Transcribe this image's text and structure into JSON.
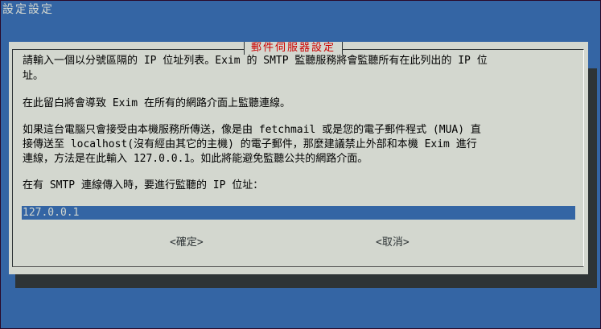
{
  "backtitle": "設定設定",
  "dialog": {
    "title": "郵件伺服器設定",
    "lines": [
      "請輸入一個以分號區隔的 IP 位址列表。Exim 的 SMTP 監聽服務將會監聽所有在此列出的 IP 位",
      "址。",
      "在此留白將會導致 Exim 在所有的網路介面上監聽連線。",
      "如果這台電腦只會接受由本機服務所傳送，像是由 fetchmail 或是您的電子郵件程式 (MUA) 直",
      "接傳送至 localhost(沒有經由其它的主機) 的電子郵件，那麼建議禁止外部和本機 Exim 進行",
      "連線，方法是在此輸入 127.0.0.1。如此將能避免監聽公共的網路介面。",
      "在有 SMTP 連線傳入時，要進行監聽的 IP 位址："
    ],
    "input_value": "127.0.0.1",
    "ok_label": "<確定>",
    "cancel_label": "<取消>"
  }
}
